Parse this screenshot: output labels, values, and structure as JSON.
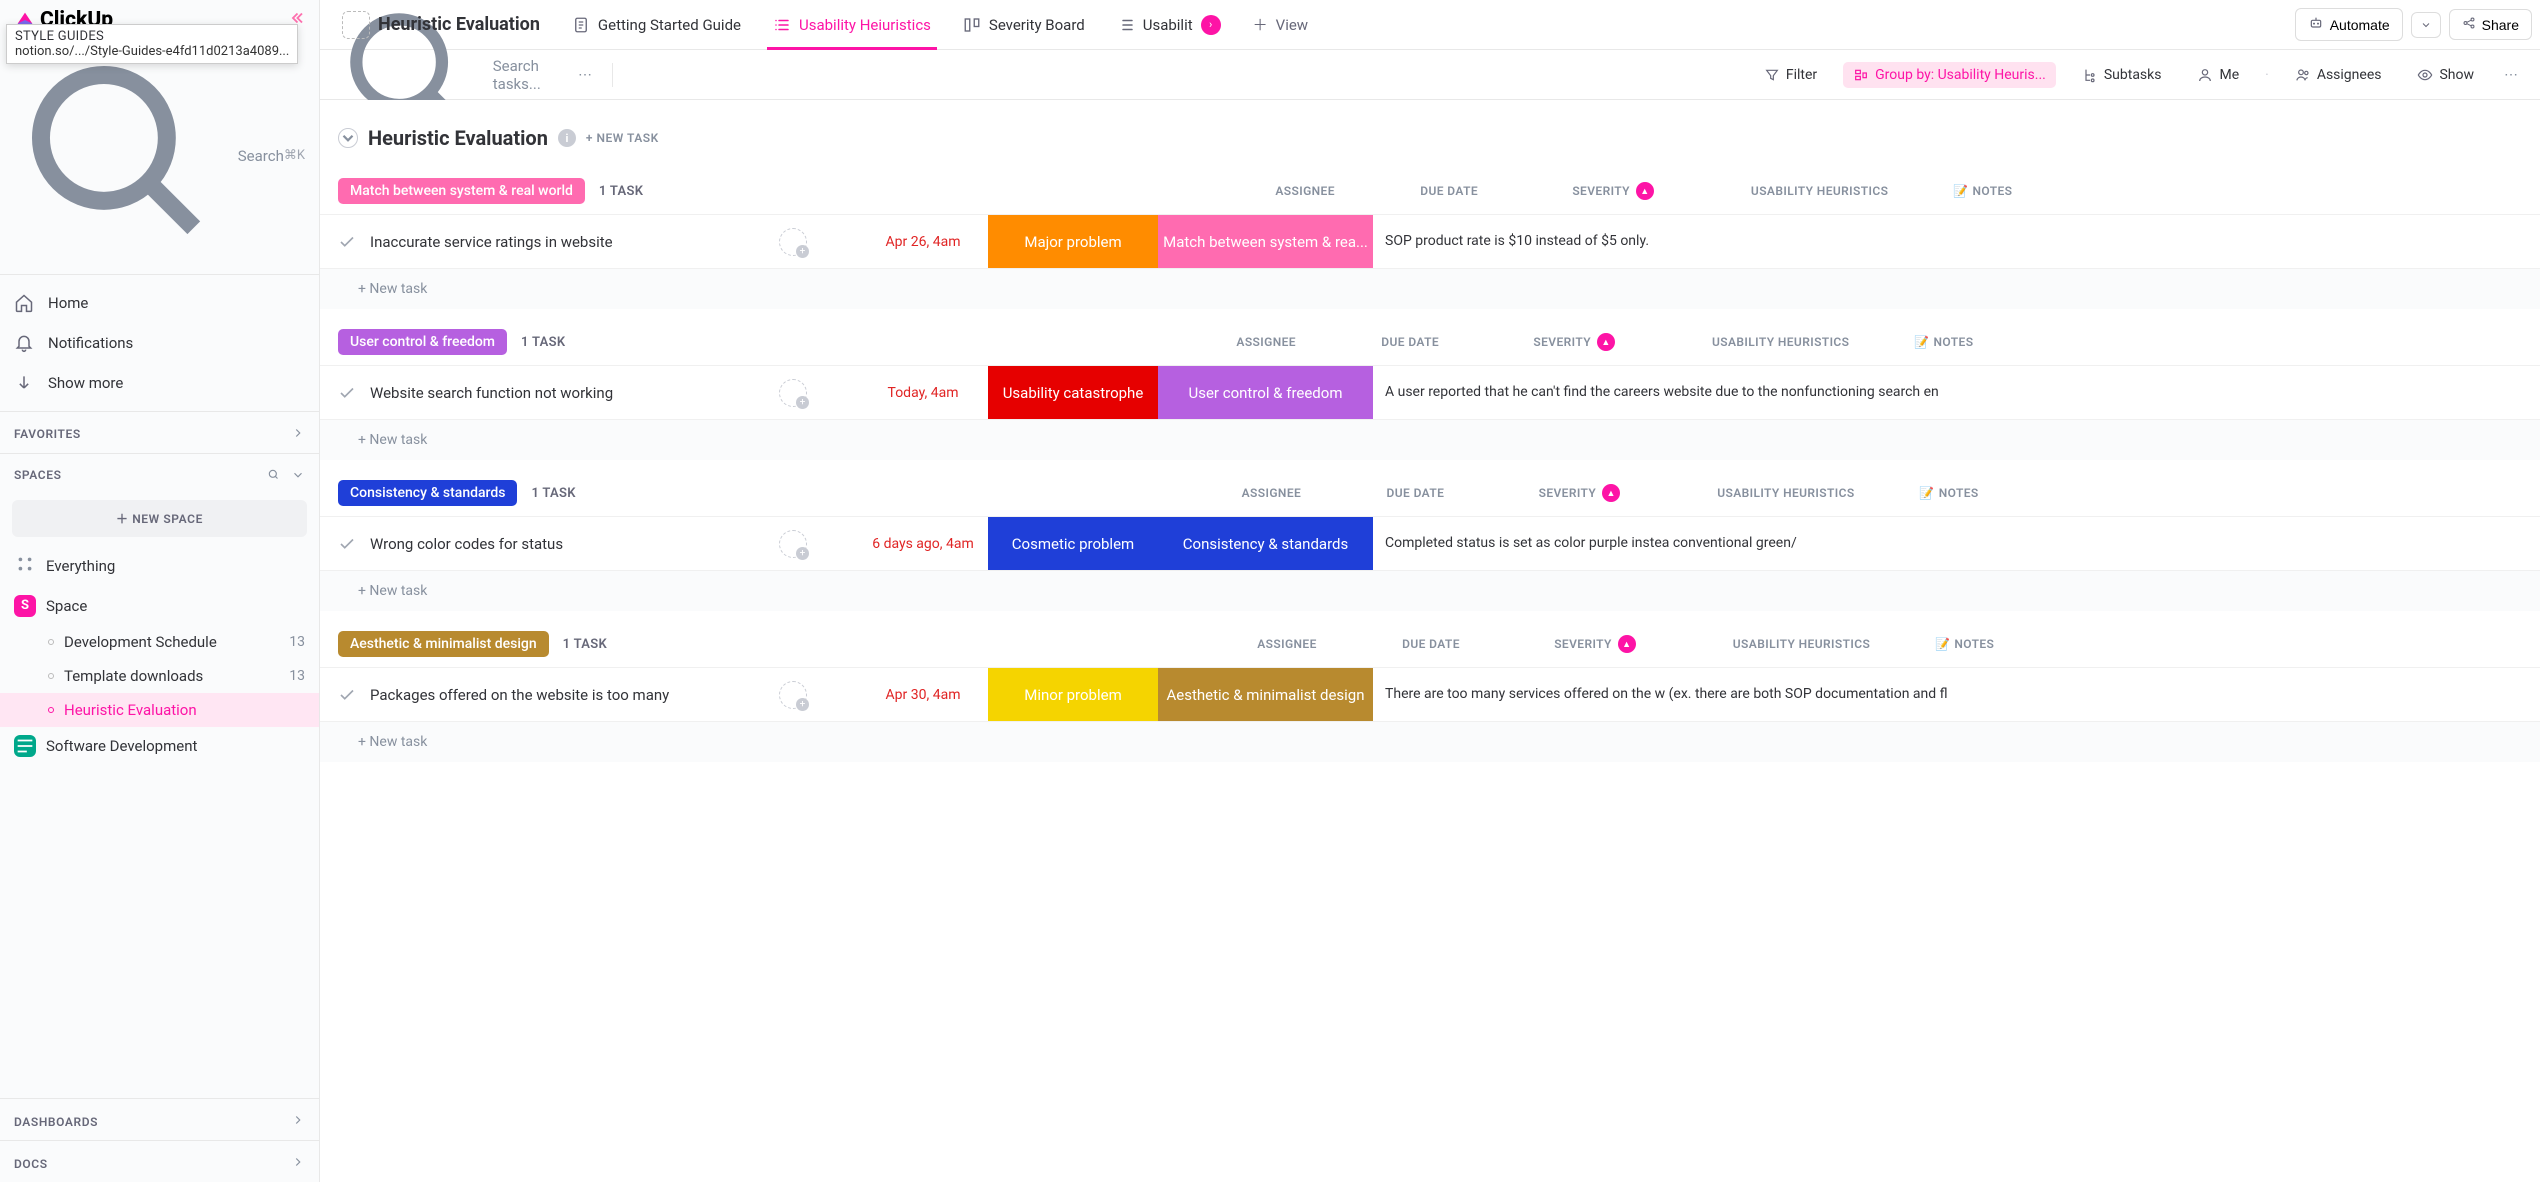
{
  "tooltip": {
    "title": "STYLE GUIDES",
    "url": "notion.so/.../Style-Guides-e4fd11d0213a4089..."
  },
  "sidebar": {
    "logo": "ClickUp",
    "search_placeholder": "Search",
    "search_shortcut": "⌘K",
    "nav": [
      {
        "label": "Home"
      },
      {
        "label": "Notifications"
      },
      {
        "label": "Show more"
      }
    ],
    "sections": {
      "favorites": "FAVORITES",
      "spaces": "SPACES",
      "dashboards": "DASHBOARDS",
      "docs": "DOCS"
    },
    "new_space": "NEW SPACE",
    "tree": {
      "everything": "Everything",
      "space": "Space",
      "items": [
        {
          "label": "Development Schedule",
          "count": "13"
        },
        {
          "label": "Template downloads",
          "count": "13"
        },
        {
          "label": "Heuristic Evaluation",
          "active": true
        }
      ],
      "software_dev": "Software Development"
    }
  },
  "tabs": {
    "title": "Heuristic Evaluation",
    "items": [
      {
        "label": "Getting Started Guide"
      },
      {
        "label": "Usability Heiuristics",
        "active": true
      },
      {
        "label": "Severity Board"
      },
      {
        "label": "Usabilit"
      }
    ],
    "add_view": "View",
    "automate": "Automate",
    "share": "Share"
  },
  "toolbar": {
    "search_placeholder": "Search tasks...",
    "filter": "Filter",
    "group_by": "Group by: Usability Heuris...",
    "subtasks": "Subtasks",
    "me": "Me",
    "assignees": "Assignees",
    "show": "Show"
  },
  "content": {
    "section_title": "Heuristic Evaluation",
    "new_task": "+ NEW TASK",
    "columns": {
      "assignee": "ASSIGNEE",
      "due": "DUE DATE",
      "severity": "SEVERITY",
      "heuristics": "USABILITY HEURISTICS",
      "notes": "NOTES"
    },
    "new_task_row": "+ New task",
    "groups": [
      {
        "label": "Match between system & real world",
        "pill_color": "#ff6bb0",
        "count": "1 TASK",
        "tasks": [
          {
            "title": "Inaccurate service ratings in website",
            "due": "Apr 26, 4am",
            "severity": {
              "label": "Major problem",
              "color": "#ff8c00"
            },
            "heuristic": {
              "label": "Match between system & rea...",
              "color": "#ff6bb0"
            },
            "notes": "SOP product rate is $10 instead of $5 only."
          }
        ]
      },
      {
        "label": "User control & freedom",
        "pill_color": "#b660e0",
        "count": "1 TASK",
        "tasks": [
          {
            "title": "Website search function not working",
            "due": "Today, 4am",
            "severity": {
              "label": "Usability catastrophe",
              "color": "#e60000"
            },
            "heuristic": {
              "label": "User control & freedom",
              "color": "#b660e0"
            },
            "notes": "A user reported that he can't find the careers website due to the nonfunctioning search en"
          }
        ]
      },
      {
        "label": "Consistency & standards",
        "pill_color": "#1f3fd8",
        "count": "1 TASK",
        "tasks": [
          {
            "title": "Wrong color codes for status",
            "due": "6 days ago, 4am",
            "severity": {
              "label": "Cosmetic problem",
              "color": "#1f3fd8"
            },
            "heuristic": {
              "label": "Consistency & standards",
              "color": "#1f3fd8"
            },
            "notes": "Completed status is set as color purple instea conventional green/"
          }
        ]
      },
      {
        "label": "Aesthetic & minimalist design",
        "pill_color": "#b88a2f",
        "count": "1 TASK",
        "tasks": [
          {
            "title": "Packages offered on the website is too many",
            "due": "Apr 30, 4am",
            "severity": {
              "label": "Minor problem",
              "color": "#f5d400"
            },
            "heuristic": {
              "label": "Aesthetic & minimalist design",
              "color": "#b88a2f"
            },
            "notes": "There are too many services offered on the w (ex. there are both SOP documentation and fl"
          }
        ]
      }
    ]
  }
}
